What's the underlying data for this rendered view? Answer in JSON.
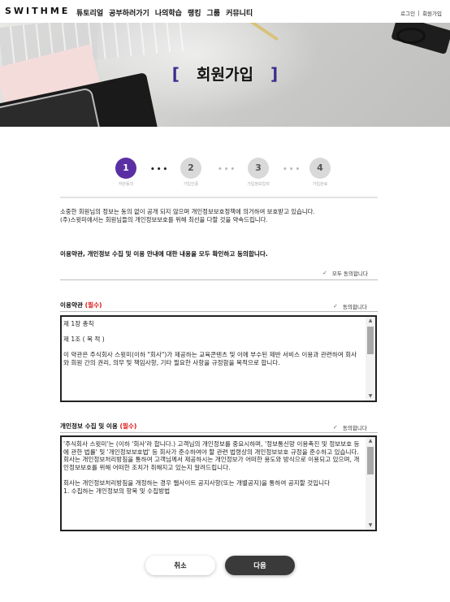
{
  "header": {
    "logo": "SWITHME",
    "nav": [
      "튜토리얼",
      "공부하러가기",
      "나의학습",
      "랭킹",
      "그룹",
      "커뮤니티"
    ],
    "login": "로그인",
    "signup": "회원가입"
  },
  "hero": {
    "title": "회원가입",
    "bracket_left": "[",
    "bracket_right": "]"
  },
  "steps": [
    {
      "number": "1",
      "label": "약관동의"
    },
    {
      "number": "2",
      "label": "가입인증"
    },
    {
      "number": "3",
      "label": "가입정보입력"
    },
    {
      "number": "4",
      "label": "가입완료"
    }
  ],
  "intro": {
    "line1": "소중한 회원님의 정보는 동의 없이 공개 되지 않으며 개인정보보호정책에 의거하여 보호받고 있습니다.",
    "line2": "(주)스윗미에서는 회원님들의 개인정보보호를 위해 최선을 다할 것을 약속드립니다."
  },
  "agree_all": {
    "text": "이용약관, 개인정보 수집 및 이용 안내에 대한 내용을 모두 확인하고 동의합니다.",
    "checkbox_label": "모두 동의합니다"
  },
  "terms": {
    "title": "이용약관",
    "required": "(필수)",
    "checkbox_label": "동의합니다",
    "content": "제 1장 총칙\n\n제 1조 ( 목 적 )\n\n이 약관은 주식회사 스윗미(이하 \"회사\")가 제공하는 교육콘텐츠 및 이에 부수된 제반 서비스 이용과 관련하여 회사와 회원 간의 권리, 의무 및 책임사항, 기타 필요한 사항을 규정함을 목적으로 합니다."
  },
  "privacy": {
    "title": "개인정보 수집 및 이용",
    "required": "(필수)",
    "checkbox_label": "동의합니다",
    "content": "'주식회사 스윗미'는 (이하 '회사'라 합니다.) 고객님의 개인정보를 중요시하며, '정보통신망 이용촉진 및 정보보호 등에 관한 법률' 및 '개인정보보호법' 등 회사가 준수하여야 할 관련 법령상의 개인정보보호 규정을 준수하고 있습니다.\n회사는 개인정보처리방침을 통하여 고객님께서 제공하시는 개인정보가 어떠한 용도와 방식으로 이용되고 있으며, 개인정보보호를 위해 어떠한 조치가 취해지고 있는지 알려드립니다.\n\n회사는 개인정보처리방침을 개정하는 경우 웹사이트 공지사항(또는 개별공지)을 통하여 공지할 것입니다\n1. 수집하는 개인정보의 항목 및 수집방법"
  },
  "buttons": {
    "cancel": "취소",
    "next": "다음"
  },
  "icons": {
    "checkbox": "✓",
    "scroll_up": "▲",
    "scroll_down": "▼"
  },
  "colors": {
    "accent": "#5b2fa4",
    "required": "#dd1111",
    "next_button": "#3a3a3a"
  }
}
